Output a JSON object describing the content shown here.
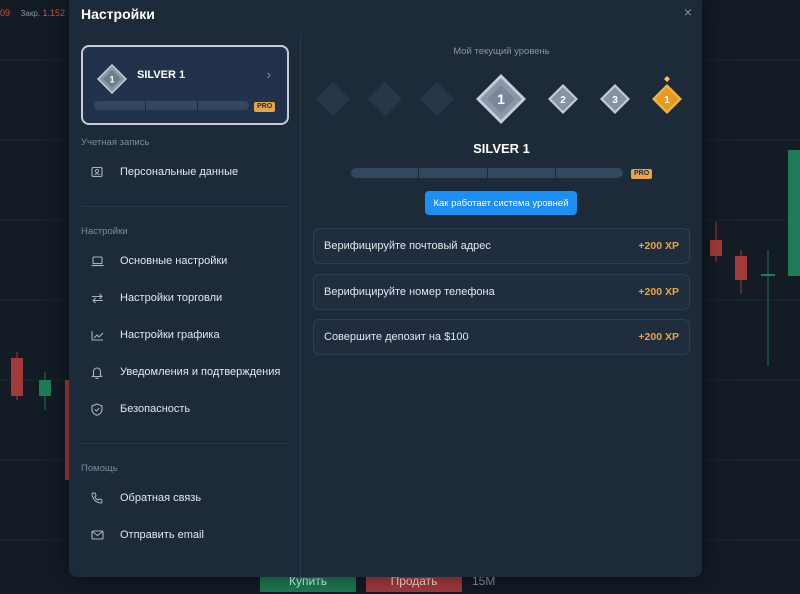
{
  "background": {
    "ticker_value": "09",
    "ticker_label": "Закр.",
    "ticker_close": "1.152",
    "buy_label": "Купить",
    "sell_label": "Продать",
    "timeframe": "15M"
  },
  "modal": {
    "title": "Настройки",
    "close": "×"
  },
  "level_card": {
    "badge_number": "1",
    "name": "SILVER 1",
    "pro_label": "PRO"
  },
  "sidebar": {
    "account_section": "Учетная запись",
    "account_items": [
      {
        "label": "Персональные данные",
        "icon": "user-card-icon"
      }
    ],
    "settings_section": "Настройки",
    "settings_items": [
      {
        "label": "Основные настройки",
        "icon": "laptop-icon"
      },
      {
        "label": "Настройки торговли",
        "icon": "trade-arrows-icon"
      },
      {
        "label": "Настройки графика",
        "icon": "chart-line-icon"
      },
      {
        "label": "Уведомления и подтверждения",
        "icon": "bell-icon"
      },
      {
        "label": "Безопасность",
        "icon": "shield-icon"
      }
    ],
    "help_section": "Помощь",
    "help_items": [
      {
        "label": "Обратная связь",
        "icon": "phone-icon"
      },
      {
        "label": "Отправить email",
        "icon": "mail-icon"
      }
    ]
  },
  "level_panel": {
    "current_label": "Мой текущий уровень",
    "levels": [
      "",
      "",
      "",
      "1",
      "2",
      "3",
      "1"
    ],
    "current_name": "SILVER 1",
    "pro_label": "PRO",
    "how_button": "Как работает система уровней"
  },
  "tasks": [
    {
      "label": "Верифицируйте почтовый адрес",
      "xp": "+200 XP"
    },
    {
      "label": "Верифицируйте номер телефона",
      "xp": "+200 XP"
    },
    {
      "label": "Совершите депозит на $100",
      "xp": "+200 XP"
    }
  ],
  "colors": {
    "accent": "#1e8ef5",
    "xp": "#e9a34a",
    "panel": "#1d2a39"
  }
}
